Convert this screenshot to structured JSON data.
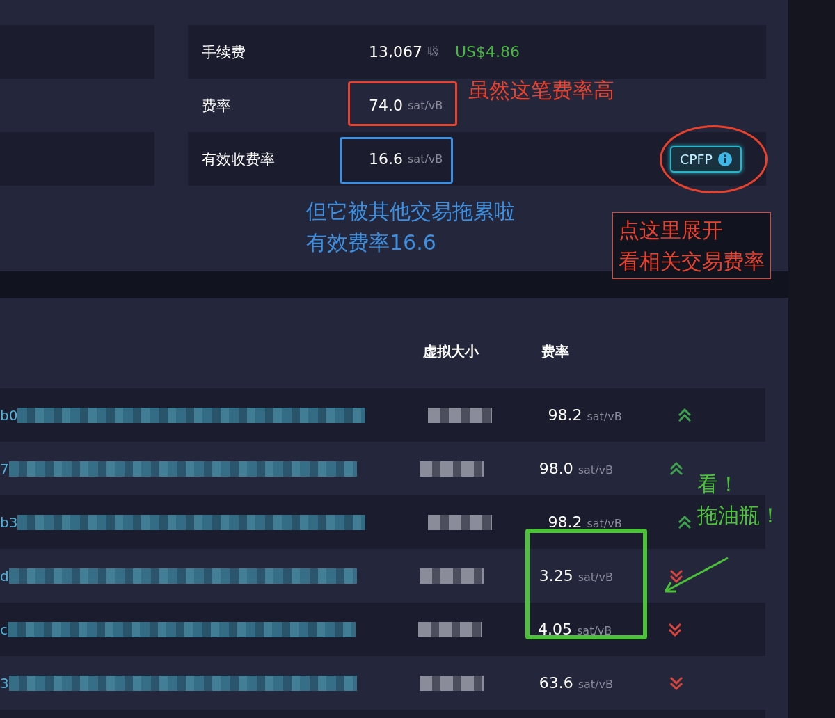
{
  "details": {
    "fee": {
      "label": "手续费",
      "value": "13,067",
      "unit": "聪",
      "fiat": "US$4.86"
    },
    "fee_rate": {
      "label": "费率",
      "value": "74.0",
      "unit": "sat/vB"
    },
    "effective_fee_rate": {
      "label": "有效收费率",
      "value": "16.6",
      "unit": "sat/vB"
    },
    "cpfp_button": {
      "label": "CPFP"
    }
  },
  "table": {
    "columns": [
      "虚拟大小",
      "费率"
    ],
    "rows": [
      {
        "txid": "b0",
        "fee": "98.2",
        "unit": "sat/vB",
        "up": true
      },
      {
        "txid": "7",
        "fee": "98.0",
        "unit": "sat/vB",
        "up": true
      },
      {
        "txid": "b3",
        "fee": "98.2",
        "unit": "sat/vB",
        "up": true
      },
      {
        "txid": "d",
        "fee": "3.25",
        "unit": "sat/vB",
        "up": false
      },
      {
        "txid": "c",
        "fee": "4.05",
        "unit": "sat/vB",
        "up": false
      },
      {
        "txid": "3",
        "fee": "63.6",
        "unit": "sat/vB",
        "up": false
      }
    ]
  },
  "annotations": [
    {
      "kind": "rect",
      "color": "#e8412c"
    },
    {
      "kind": "note",
      "color": "#e8412c",
      "lines": [
        "虽然这笔费率高"
      ]
    },
    {
      "kind": "rect",
      "color": "#3d8fe0"
    },
    {
      "kind": "note",
      "color": "#3d8fe0",
      "lines": [
        "但它被其他交易拖累啦",
        "有效费率16.6"
      ]
    },
    {
      "kind": "ellipse",
      "color": "#e8412c"
    },
    {
      "kind": "boxed-note",
      "color": "#e8412c",
      "lines": [
        "点这里展开",
        "看相关交易费率"
      ]
    },
    {
      "kind": "note",
      "color": "#4cc238",
      "lines": [
        "看！",
        "拖油瓶！"
      ]
    },
    {
      "kind": "rect",
      "color": "#4cc238"
    },
    {
      "kind": "arrow",
      "color": "#4cc238"
    }
  ]
}
